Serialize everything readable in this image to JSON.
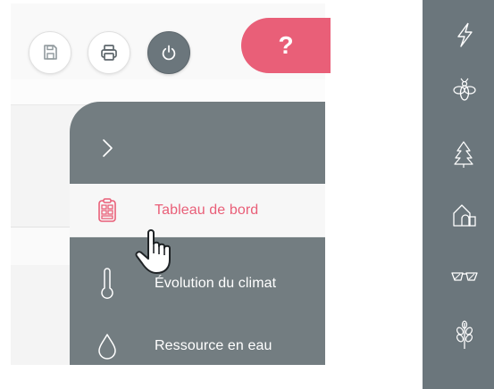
{
  "toolbar": {
    "save_icon": "floppy-disk-icon",
    "print_icon": "printer-icon",
    "power_icon": "power-icon",
    "help_label": "?"
  },
  "drawer": {
    "toggle_icon": "chevron-right-icon",
    "items": [
      {
        "label": "Tableau de bord",
        "icon": "dashboard-icon",
        "active": true
      },
      {
        "label": "Évolution du climat",
        "icon": "thermometer-icon",
        "active": false
      },
      {
        "label": "Ressource en eau",
        "icon": "water-drop-icon",
        "active": false
      }
    ]
  },
  "right_rail": {
    "items": [
      {
        "icon": "lightning-icon"
      },
      {
        "icon": "bee-icon"
      },
      {
        "icon": "trees-icon"
      },
      {
        "icon": "house-icon"
      },
      {
        "icon": "glasses-icon"
      },
      {
        "icon": "wheat-icon"
      }
    ]
  },
  "colors": {
    "accent": "#e95f78",
    "drawer_bg": "#737d81",
    "rail_bg": "#6b767c",
    "active_bg": "#f7f7f7"
  }
}
